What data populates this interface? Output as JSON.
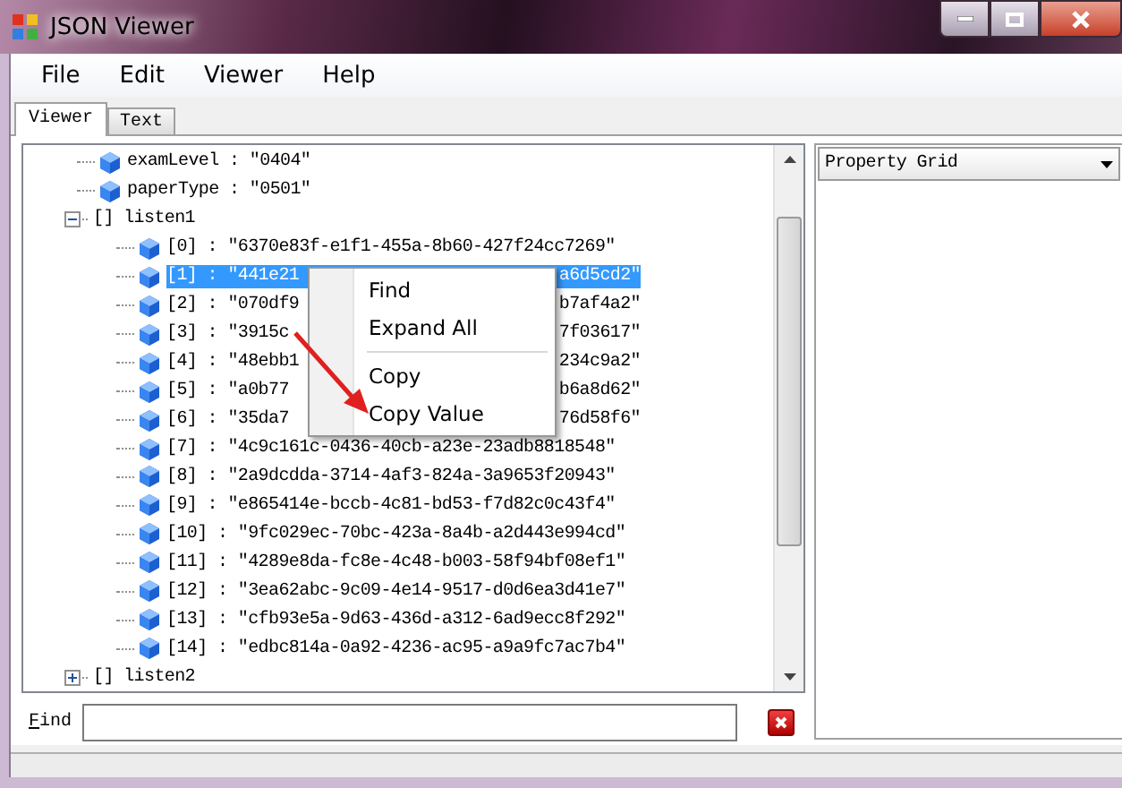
{
  "window": {
    "title": "JSON Viewer"
  },
  "menu": [
    "File",
    "Edit",
    "Viewer",
    "Help"
  ],
  "tabs": [
    {
      "label": "Viewer",
      "selected": true
    },
    {
      "label": "Text",
      "selected": false
    }
  ],
  "tree": [
    {
      "kind": "value",
      "parts": [
        "examLevel : \"0404\""
      ],
      "selected": false
    },
    {
      "kind": "value",
      "parts": [
        "paperType : \"0501\""
      ],
      "selected": false
    },
    {
      "kind": "array",
      "label": "[] listen1",
      "expanded": true,
      "children": [
        {
          "kind": "value",
          "parts": [
            "[0] : \"6370e83f-e1f1-455a-8b60-427f24cc7269\""
          ],
          "selected": false
        },
        {
          "kind": "value",
          "parts": [
            "[1] : \"441e21",
            "a6d5cd2\""
          ],
          "selected": true
        },
        {
          "kind": "value",
          "parts": [
            "[2] : \"070df9",
            "b7af4a2\""
          ],
          "selected": false
        },
        {
          "kind": "value",
          "parts": [
            "[3] : \"3915c",
            "7f03617\""
          ],
          "selected": false
        },
        {
          "kind": "value",
          "parts": [
            "[4] : \"48ebb1",
            "234c9a2\""
          ],
          "selected": false
        },
        {
          "kind": "value",
          "parts": [
            "[5] : \"a0b77",
            "b6a8d62\""
          ],
          "selected": false
        },
        {
          "kind": "value",
          "parts": [
            "[6] : \"35da7",
            "76d58f6\""
          ],
          "selected": false
        },
        {
          "kind": "value",
          "parts": [
            "[7] : \"4c9c161c-0436-40cb-a23e-23adb8818548\""
          ],
          "selected": false
        },
        {
          "kind": "value",
          "parts": [
            "[8] : \"2a9dcdda-3714-4af3-824a-3a9653f20943\""
          ],
          "selected": false
        },
        {
          "kind": "value",
          "parts": [
            "[9] : \"e865414e-bccb-4c81-bd53-f7d82c0c43f4\""
          ],
          "selected": false
        },
        {
          "kind": "value",
          "parts": [
            "[10] : \"9fc029ec-70bc-423a-8a4b-a2d443e994cd\""
          ],
          "selected": false
        },
        {
          "kind": "value",
          "parts": [
            "[11] : \"4289e8da-fc8e-4c48-b003-58f94bf08ef1\""
          ],
          "selected": false
        },
        {
          "kind": "value",
          "parts": [
            "[12] : \"3ea62abc-9c09-4e14-9517-d0d6ea3d41e7\""
          ],
          "selected": false
        },
        {
          "kind": "value",
          "parts": [
            "[13] : \"cfb93e5a-9d63-436d-a312-6ad9ecc8f292\""
          ],
          "selected": false
        },
        {
          "kind": "value",
          "parts": [
            "[14] : \"edbc814a-0a92-4236-ac95-a9a9fc7ac7b4\""
          ],
          "selected": false
        }
      ]
    },
    {
      "kind": "array",
      "label": "[] listen2",
      "expanded": false
    }
  ],
  "context_menu": [
    {
      "kind": "item",
      "label": "Find"
    },
    {
      "kind": "item",
      "label": "Expand All"
    },
    {
      "kind": "separator"
    },
    {
      "kind": "item",
      "label": "Copy"
    },
    {
      "kind": "item",
      "label": "Copy Value"
    }
  ],
  "find": {
    "label": "Find"
  },
  "property_grid": {
    "label": "Property Grid"
  }
}
